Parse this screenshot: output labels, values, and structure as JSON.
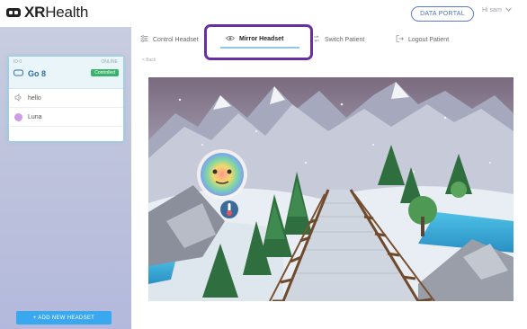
{
  "brand": {
    "bold": "XR",
    "light": "Health"
  },
  "header": {
    "data_portal_label": "DATA PORTAL",
    "user_greeting": "Hi sam"
  },
  "headset_card": {
    "meta_left": "ID:0",
    "meta_right": "ONLINE",
    "name": "Go 8",
    "status_badge": "Controlled",
    "patients": [
      {
        "name": "hello"
      },
      {
        "name": "Luna"
      }
    ]
  },
  "sidebar": {
    "add_headset_label": "+ ADD NEW HEADSET"
  },
  "tabs": [
    {
      "label": "Control Headset"
    },
    {
      "label": "Mirror Headset"
    },
    {
      "label": "Switch Patient"
    },
    {
      "label": "Logout Patient"
    }
  ],
  "back_label": "< Back",
  "colors": {
    "accent": "#3aa8ef",
    "highlight": "#6a2fa0",
    "badge": "#39b36b",
    "sidebar": "#bcc1dc"
  }
}
